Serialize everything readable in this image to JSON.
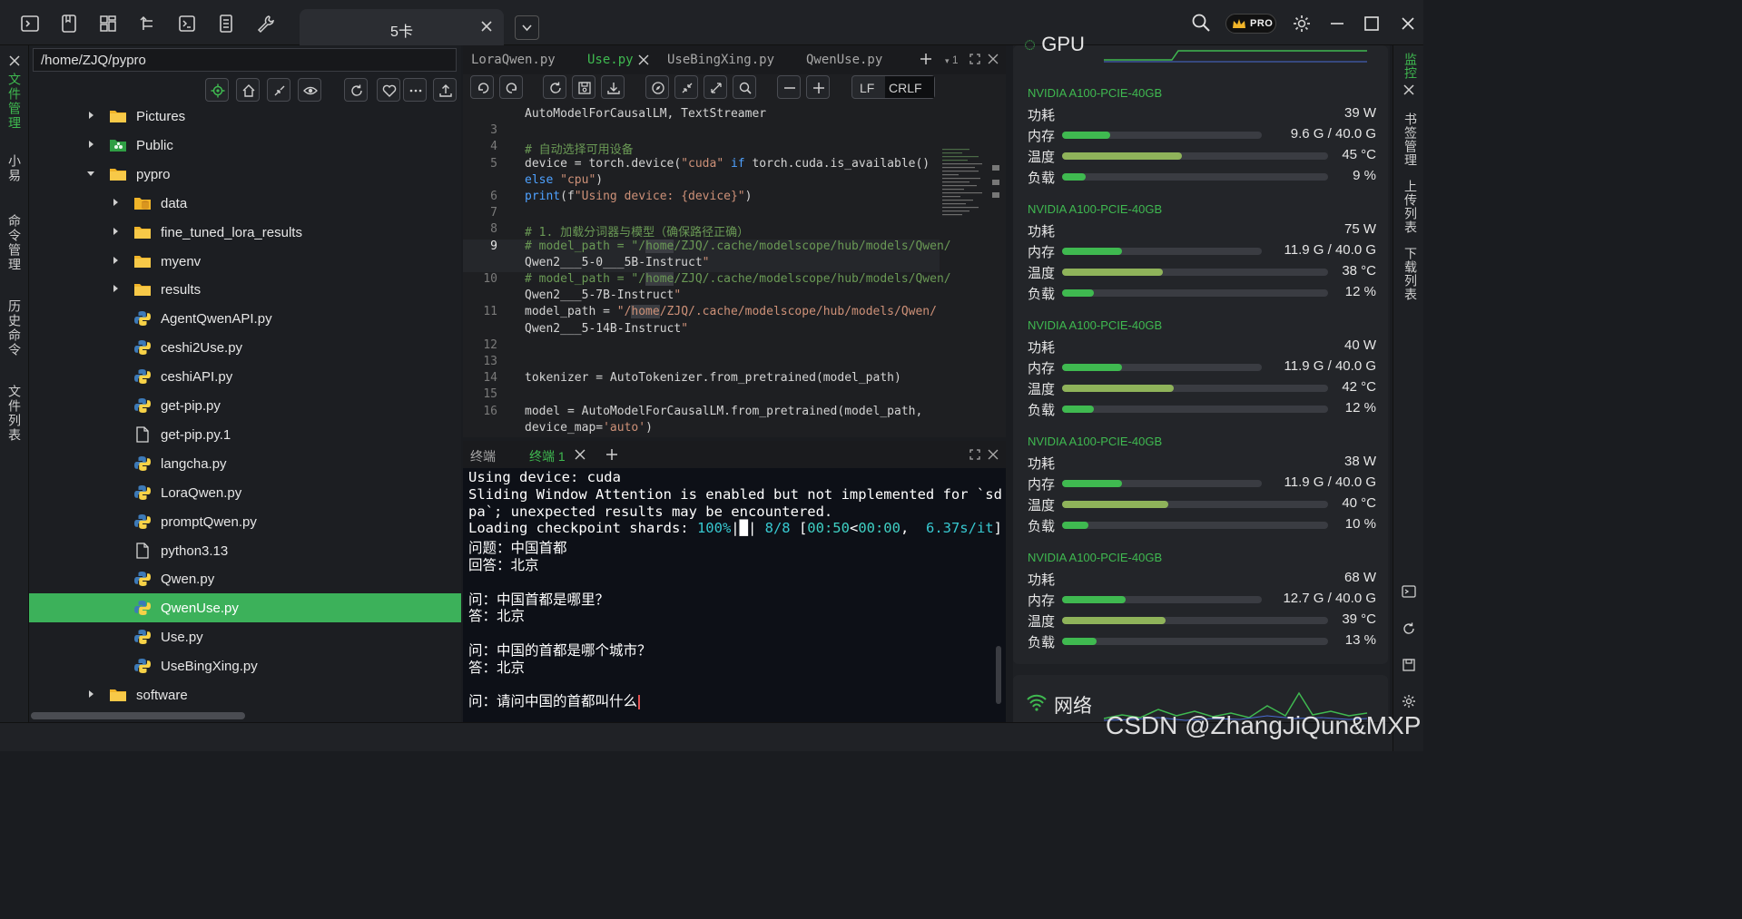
{
  "titlebar": {
    "tab_label": "5卡",
    "pro_label": "PRO"
  },
  "left_rail": [
    "文件管理",
    "小易",
    "命令管理",
    "历史命令",
    "文件列表"
  ],
  "explorer": {
    "path": "/home/ZJQ/pypro",
    "tree": [
      {
        "name": "Pictures",
        "type": "folder",
        "expanded": false
      },
      {
        "name": "Public",
        "type": "folder-public",
        "expanded": false
      },
      {
        "name": "pypro",
        "type": "folder",
        "expanded": true
      },
      {
        "name": "data",
        "type": "folder-db",
        "expanded": false
      },
      {
        "name": "fine_tuned_lora_results",
        "type": "folder",
        "expanded": false
      },
      {
        "name": "myenv",
        "type": "folder",
        "expanded": false
      },
      {
        "name": "results",
        "type": "folder",
        "expanded": false
      },
      {
        "name": "AgentQwenAPI.py",
        "type": "python"
      },
      {
        "name": "ceshi2Use.py",
        "type": "python"
      },
      {
        "name": "ceshiAPI.py",
        "type": "python"
      },
      {
        "name": "get-pip.py",
        "type": "python"
      },
      {
        "name": "get-pip.py.1",
        "type": "file"
      },
      {
        "name": "langcha.py",
        "type": "python"
      },
      {
        "name": "LoraQwen.py",
        "type": "python"
      },
      {
        "name": "promptQwen.py",
        "type": "python"
      },
      {
        "name": "python3.13",
        "type": "file"
      },
      {
        "name": "Qwen.py",
        "type": "python"
      },
      {
        "name": "QwenUse.py",
        "type": "python",
        "selected": true
      },
      {
        "name": "Use.py",
        "type": "python"
      },
      {
        "name": "UseBingXing.py",
        "type": "python"
      },
      {
        "name": "software",
        "type": "folder",
        "expanded": false
      }
    ]
  },
  "editor": {
    "tabs": [
      "LoraQwen.py",
      "Use.py",
      "UseBingXing.py",
      "QwenUse.py"
    ],
    "active_tab": "Use.py",
    "split_count": "1",
    "lf_label": "LF",
    "crlf_label": "CRLF",
    "lines": [
      {
        "n": "",
        "t": "AutoModelForCausalLM, TextStreamer"
      },
      {
        "n": "3",
        "t": ""
      },
      {
        "n": "4",
        "t": "# 自动选择可用设备"
      },
      {
        "n": "5",
        "t": "device = torch.device(\"cuda\" if torch.cuda.is_available()"
      },
      {
        "n": "",
        "t": "else \"cpu\")"
      },
      {
        "n": "6",
        "t": "print(f\"Using device: {device}\")"
      },
      {
        "n": "7",
        "t": ""
      },
      {
        "n": "8",
        "t": "# 1. 加载分词器与模型（确保路径正确）"
      },
      {
        "n": "9",
        "t": "# model_path = \"/home/ZJQ/.cache/modelscope/hub/models/Qwen/"
      },
      {
        "n": "",
        "t": "Qwen2___5-0___5B-Instruct\""
      },
      {
        "n": "10",
        "t": "# model_path = \"/home/ZJQ/.cache/modelscope/hub/models/Qwen/"
      },
      {
        "n": "",
        "t": "Qwen2___5-7B-Instruct\""
      },
      {
        "n": "11",
        "t": "model_path = \"/home/ZJQ/.cache/modelscope/hub/models/Qwen/"
      },
      {
        "n": "",
        "t": "Qwen2___5-14B-Instruct\""
      },
      {
        "n": "12",
        "t": ""
      },
      {
        "n": "13",
        "t": ""
      },
      {
        "n": "14",
        "t": "tokenizer = AutoTokenizer.from_pretrained(model_path)"
      },
      {
        "n": "15",
        "t": ""
      },
      {
        "n": "16",
        "t": "model = AutoModelForCausalLM.from_pretrained(model_path,"
      },
      {
        "n": "",
        "t": "device_map='auto')"
      }
    ]
  },
  "terminal": {
    "tab_inactive": "终端",
    "tab_active": "终端 1",
    "lines": [
      "Using device: cuda",
      "Sliding Window Attention is enabled but not implemented for `sd",
      "pa`; unexpected results may be encountered.",
      "Loading checkpoint shards: 100%|█| 8/8 [00:50<00:00,  6.37s/it]",
      "问题：中国首都",
      "回答：北京",
      "",
      "问：中国首都是哪里？",
      "答：北京",
      "",
      "问：中国的首都是哪个城市？",
      "答：北京",
      "",
      "问：请问中国的首都叫什么"
    ]
  },
  "monitor": {
    "gpu_header": "GPU",
    "labels": {
      "power": "功耗",
      "memory": "内存",
      "temp": "温度",
      "load": "负载"
    },
    "gpus": [
      {
        "name": "NVIDIA A100-PCIE-40GB",
        "power": "39 W",
        "memory": "9.6 G / 40.0 G",
        "mem_frac": 0.24,
        "temp": "45 °C",
        "temp_frac": 0.45,
        "load": "9 %",
        "load_frac": 0.09
      },
      {
        "name": "NVIDIA A100-PCIE-40GB",
        "power": "75 W",
        "memory": "11.9 G / 40.0 G",
        "mem_frac": 0.3,
        "temp": "38 °C",
        "temp_frac": 0.38,
        "load": "12 %",
        "load_frac": 0.12
      },
      {
        "name": "NVIDIA A100-PCIE-40GB",
        "power": "40 W",
        "memory": "11.9 G / 40.0 G",
        "mem_frac": 0.3,
        "temp": "42 °C",
        "temp_frac": 0.42,
        "load": "12 %",
        "load_frac": 0.12
      },
      {
        "name": "NVIDIA A100-PCIE-40GB",
        "power": "38 W",
        "memory": "11.9 G / 40.0 G",
        "mem_frac": 0.3,
        "temp": "40 °C",
        "temp_frac": 0.4,
        "load": "10 %",
        "load_frac": 0.1
      },
      {
        "name": "NVIDIA A100-PCIE-40GB",
        "power": "68 W",
        "memory": "12.7 G / 40.0 G",
        "mem_frac": 0.32,
        "temp": "39 °C",
        "temp_frac": 0.39,
        "load": "13 %",
        "load_frac": 0.13
      }
    ],
    "network_label": "网络"
  },
  "right_rail": [
    "监控",
    "书签管理",
    "上传列表",
    "下载列表"
  ],
  "watermark": "CSDN @ZhangJiQun&MXP",
  "colors": {
    "accent": "#3fb950",
    "mem_bar": "#3fb950",
    "temp_bar": "#8fb35a",
    "load_bar": "#3fb950",
    "selected_row": "#3cb15a"
  }
}
